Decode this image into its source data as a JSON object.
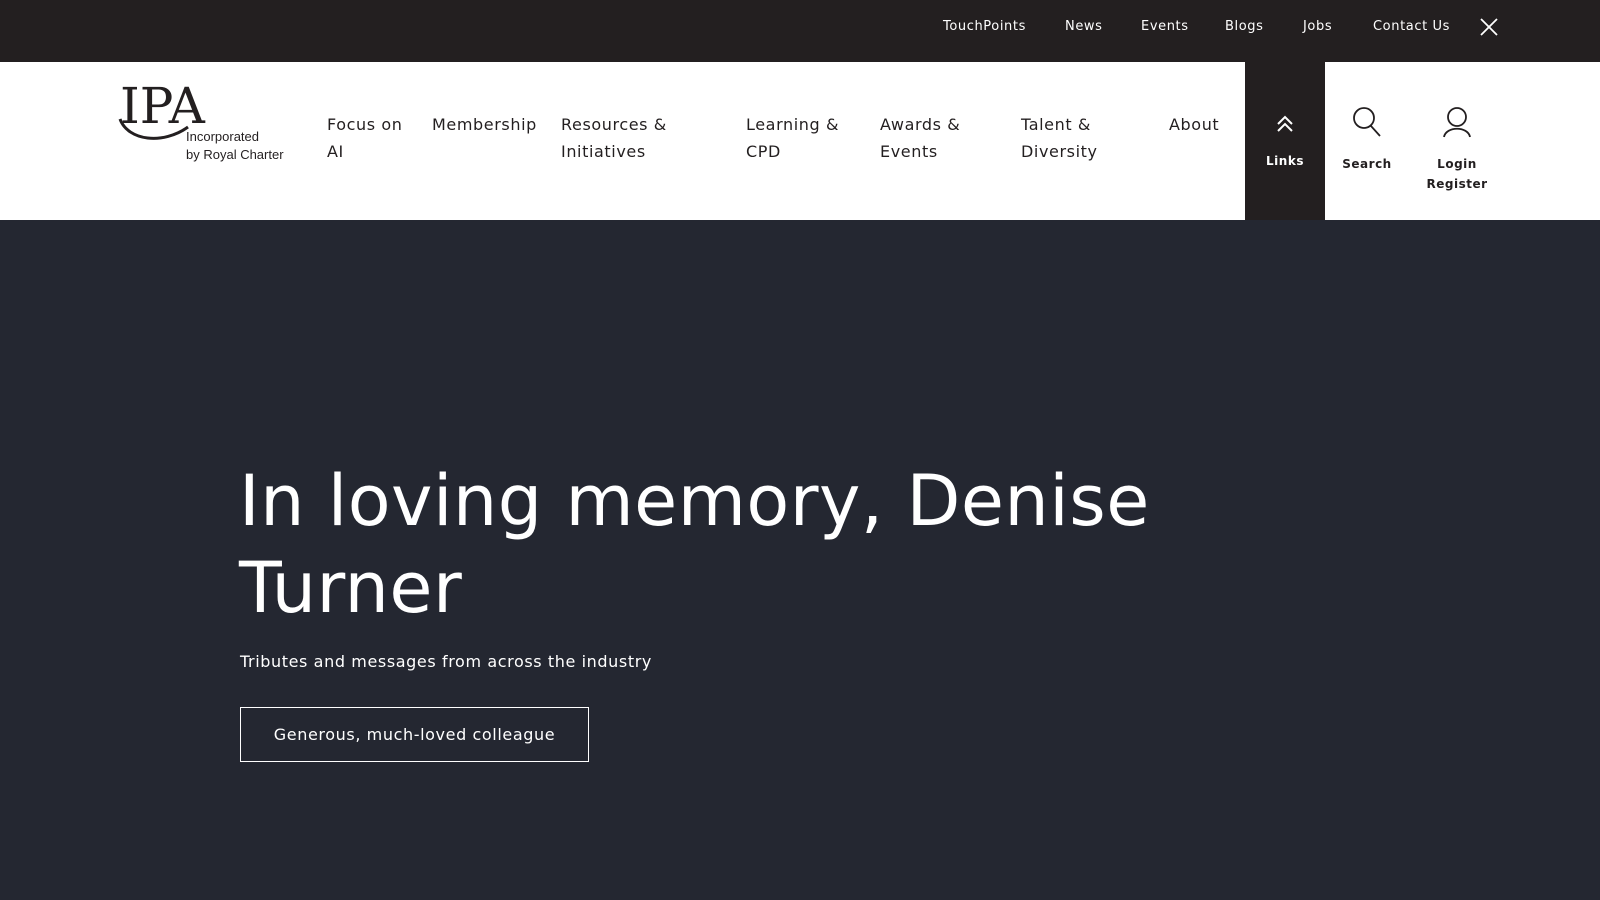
{
  "topbar": {
    "links": [
      "TouchPoints",
      "News",
      "Events",
      "Blogs",
      "Jobs",
      "Contact Us"
    ]
  },
  "logo": {
    "mark": "IPA",
    "line1": "Incorporated",
    "line2": "by Royal Charter"
  },
  "nav": {
    "items": [
      {
        "line1": "Focus on",
        "line2": "AI"
      },
      {
        "line1": "Membership",
        "line2": ""
      },
      {
        "line1": "Resources &",
        "line2": "Initiatives"
      },
      {
        "line1": "Learning &",
        "line2": "CPD"
      },
      {
        "line1": "Awards &",
        "line2": "Events"
      },
      {
        "line1": "Talent &",
        "line2": "Diversity"
      },
      {
        "line1": "About",
        "line2": ""
      }
    ],
    "links_label": "Links",
    "search_label": "Search",
    "login_label": "Login",
    "register_label": "Register"
  },
  "hero": {
    "title_line1": "In loving memory, Denise",
    "title_line2": "Turner",
    "subtitle": "Tributes and messages from across the industry",
    "button_label": "Generous, much-loved colleague"
  },
  "colors": {
    "topbar_bg": "#231f20",
    "header_bg": "#ffffff",
    "hero_bg": "#242731",
    "text_dark": "#231f20",
    "text_light": "#ffffff"
  },
  "icons": {
    "close": "close-icon",
    "links": "double-chevron-up-icon",
    "search": "search-icon",
    "user": "user-icon"
  }
}
